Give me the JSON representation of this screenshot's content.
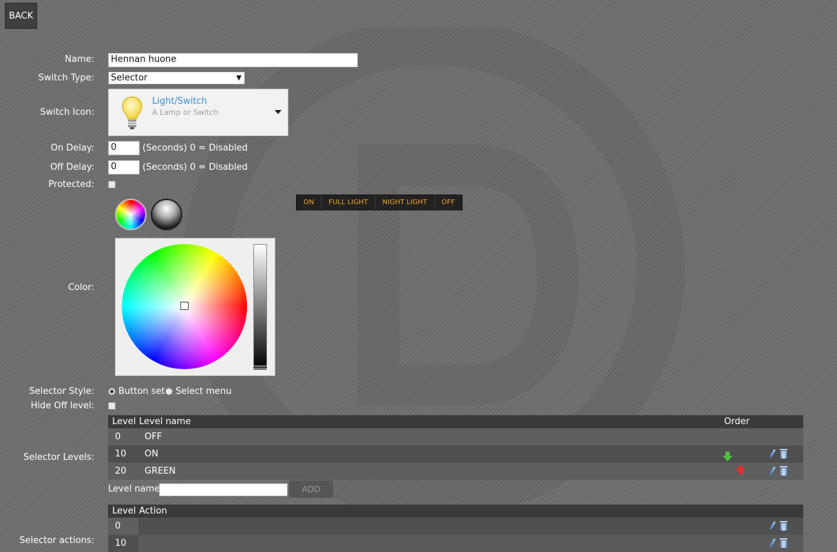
{
  "back_label": "BACK",
  "form": {
    "name_label": "Name:",
    "name_value": "Hennan huone",
    "switch_type_label": "Switch Type:",
    "switch_type_value": "Selector",
    "switch_icon_label": "Switch Icon:",
    "switch_icon_title": "Light/Switch",
    "switch_icon_desc": "A Lamp or Switch",
    "on_delay_label": "On Delay:",
    "on_delay_value": "0",
    "off_delay_label": "Off Delay:",
    "off_delay_value": "0",
    "delay_hint": "(Seconds) 0 = Disabled",
    "protected_label": "Protected:",
    "color_label": "Color:",
    "selector_style_label": "Selector Style:",
    "style_buttonset": "Button set",
    "style_selectmenu": "Select menu",
    "hide_off_label": "Hide Off level:",
    "selector_levels_label": "Selector Levels:",
    "level_name_label": "Level name:",
    "level_name_value": "",
    "add_label": "ADD",
    "selector_actions_label": "Selector actions:"
  },
  "button_preview": [
    "ON",
    "FULL LIGHT",
    "NIGHT LIGHT",
    "OFF"
  ],
  "levels_table": {
    "headers": {
      "level": "Level",
      "name": "Level name",
      "order": "Order"
    },
    "rows": [
      {
        "level": "0",
        "name": "OFF"
      },
      {
        "level": "10",
        "name": "ON"
      },
      {
        "level": "20",
        "name": "GREEN"
      }
    ]
  },
  "actions_table": {
    "headers": {
      "level": "Level",
      "action": "Action"
    },
    "rows": [
      {
        "level": "0"
      },
      {
        "level": "10"
      }
    ]
  },
  "colors": {
    "accent_orange": "#f5a623",
    "link_blue": "#3b8fd0",
    "arrow_green": "#4ac83a",
    "arrow_red": "#e53030"
  },
  "icons": {
    "lightbulb": "lightbulb-icon",
    "move_down": "arrow-down-icon",
    "move_up": "arrow-up-icon",
    "edit": "pencil-icon",
    "delete": "trash-icon"
  }
}
